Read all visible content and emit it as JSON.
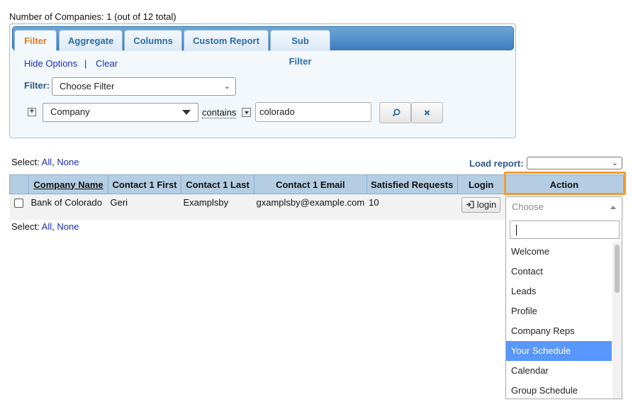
{
  "summary": {
    "count_text": "Number of Companies: 1 (out of 12 total)"
  },
  "tabs": [
    {
      "label": "Filter",
      "active": true
    },
    {
      "label": "Aggregate",
      "active": false
    },
    {
      "label": "Columns",
      "active": false
    },
    {
      "label": "Custom Report",
      "active": false
    },
    {
      "label": "Sub Filter",
      "active": false
    }
  ],
  "filter_panel": {
    "hide_options": "Hide Options",
    "separator": "|",
    "clear": "Clear",
    "filter_label": "Filter:",
    "choose_filter": "Choose Filter",
    "field": "Company",
    "operator": "contains",
    "value": "colorado",
    "search_icon": "magnifier-icon",
    "clear_icon": "x-icon"
  },
  "select_controls": {
    "label": "Select:",
    "all": "All",
    "comma": ",",
    "none": "None"
  },
  "load_report": {
    "label": "Load report:",
    "value": ""
  },
  "table": {
    "columns": [
      "Company Name",
      "Contact 1 First",
      "Contact 1 Last",
      "Contact 1 Email",
      "Satisfied Requests",
      "Login",
      "Action"
    ],
    "rows": [
      {
        "company": "Bank of Colorado",
        "first": "Geri",
        "last": "Examplsby",
        "email": "gxamplsby@example.com",
        "requests": "10",
        "login": "login"
      }
    ]
  },
  "action_dropdown": {
    "placeholder": "Choose",
    "search_value": "",
    "options": [
      "Welcome",
      "Contact",
      "Leads",
      "Profile",
      "Company Reps",
      "Your Schedule",
      "Calendar",
      "Group Schedule"
    ],
    "highlighted": "Your Schedule"
  },
  "colors": {
    "highlight_border": "#f39a2d",
    "header_bg": "#b4cde3",
    "option_highlight": "#5897fb",
    "active_tab_text": "#e67a1a"
  }
}
